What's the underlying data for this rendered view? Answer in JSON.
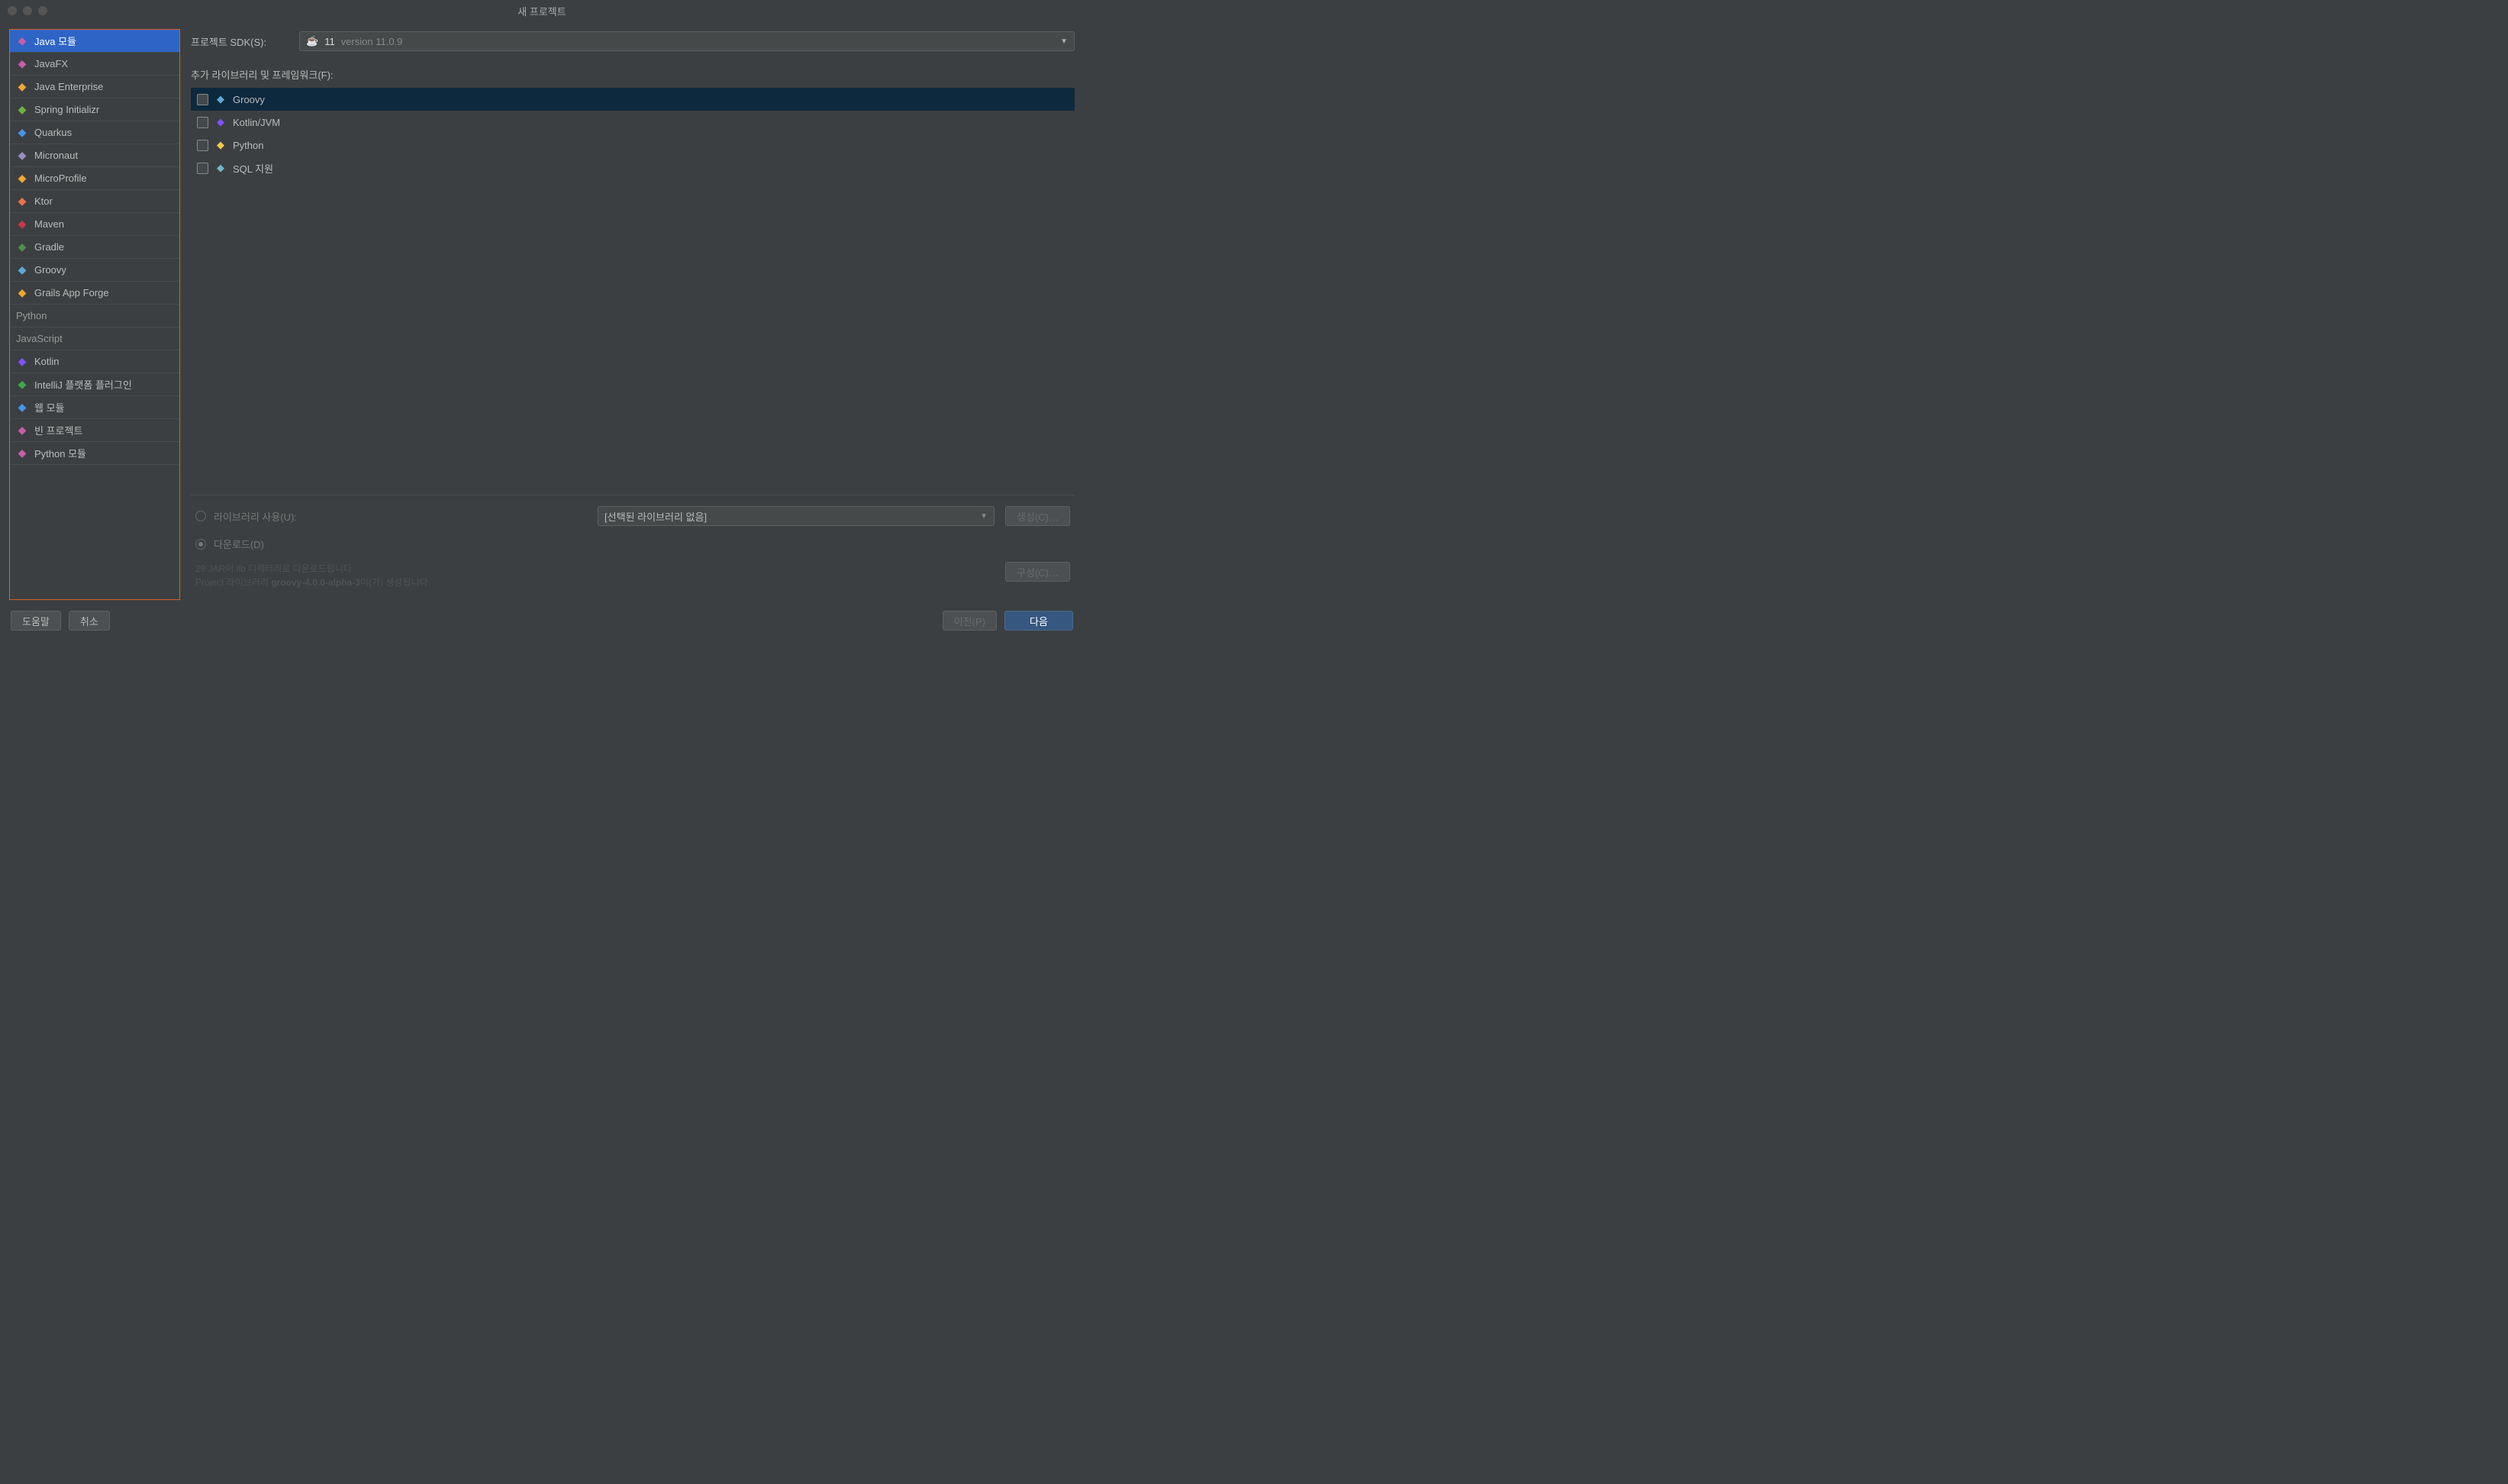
{
  "window": {
    "title": "새 프로젝트"
  },
  "sidebar": {
    "items": [
      {
        "label": "Java 모듈",
        "iconColor": "#c75ca8",
        "selected": true
      },
      {
        "label": "JavaFX",
        "iconColor": "#c75ca8"
      },
      {
        "label": "Java Enterprise",
        "iconColor": "#f0a732"
      },
      {
        "label": "Spring Initializr",
        "iconColor": "#6db33f"
      },
      {
        "label": "Quarkus",
        "iconColor": "#4695eb"
      },
      {
        "label": "Micronaut",
        "iconColor": "#9a8fbb"
      },
      {
        "label": "MicroProfile",
        "iconColor": "#f0a732"
      },
      {
        "label": "Ktor",
        "iconColor": "#e8744b"
      },
      {
        "label": "Maven",
        "iconColor": "#c9354b"
      },
      {
        "label": "Gradle",
        "iconColor": "#4c8f4a"
      },
      {
        "label": "Groovy",
        "iconColor": "#5fa8d3"
      },
      {
        "label": "Grails App Forge",
        "iconColor": "#f0a732"
      },
      {
        "label": "Python",
        "category": true
      },
      {
        "label": "JavaScript",
        "category": true
      },
      {
        "label": "Kotlin",
        "iconColor": "#7f52ff"
      },
      {
        "label": "IntelliJ 플랫폼 플러그인",
        "iconColor": "#3fa94b"
      },
      {
        "label": "웹 모듈",
        "iconColor": "#4695eb"
      },
      {
        "label": "빈 프로젝트",
        "iconColor": "#c75ca8"
      },
      {
        "label": "Python 모듈",
        "iconColor": "#c75ca8"
      }
    ]
  },
  "sdk": {
    "label": "프로젝트 SDK(S):",
    "valuePrefix": "11",
    "valueSuffix": "version 11.0.9"
  },
  "frameworks": {
    "label": "추가 라이브러리 및 프레임워크(F):",
    "items": [
      {
        "label": "Groovy",
        "iconColor": "#5fa8d3",
        "active": true
      },
      {
        "label": "Kotlin/JVM",
        "iconColor": "#7f52ff"
      },
      {
        "label": "Python",
        "iconColor": "#f2c94c"
      },
      {
        "label": "SQL 지원",
        "iconColor": "#6fb7c6"
      }
    ]
  },
  "library": {
    "useLabel": "라이브러리 사용(U):",
    "downloadLabel": "다운로드(D)",
    "selectedText": "[선택된 라이브러리 없음]",
    "createBtn": "생성(C)…",
    "configBtn": "구성(C)…",
    "info1": "29 JAR이 lib 디렉터리로 다운로드됩니다",
    "info2a": "Project 라이브러리 ",
    "info2b": "groovy-4.0.0-alpha-3",
    "info2c": "이(가) 생성됩니다"
  },
  "footer": {
    "help": "도움말",
    "cancel": "취소",
    "prev": "이전(P)",
    "next": "다음"
  }
}
